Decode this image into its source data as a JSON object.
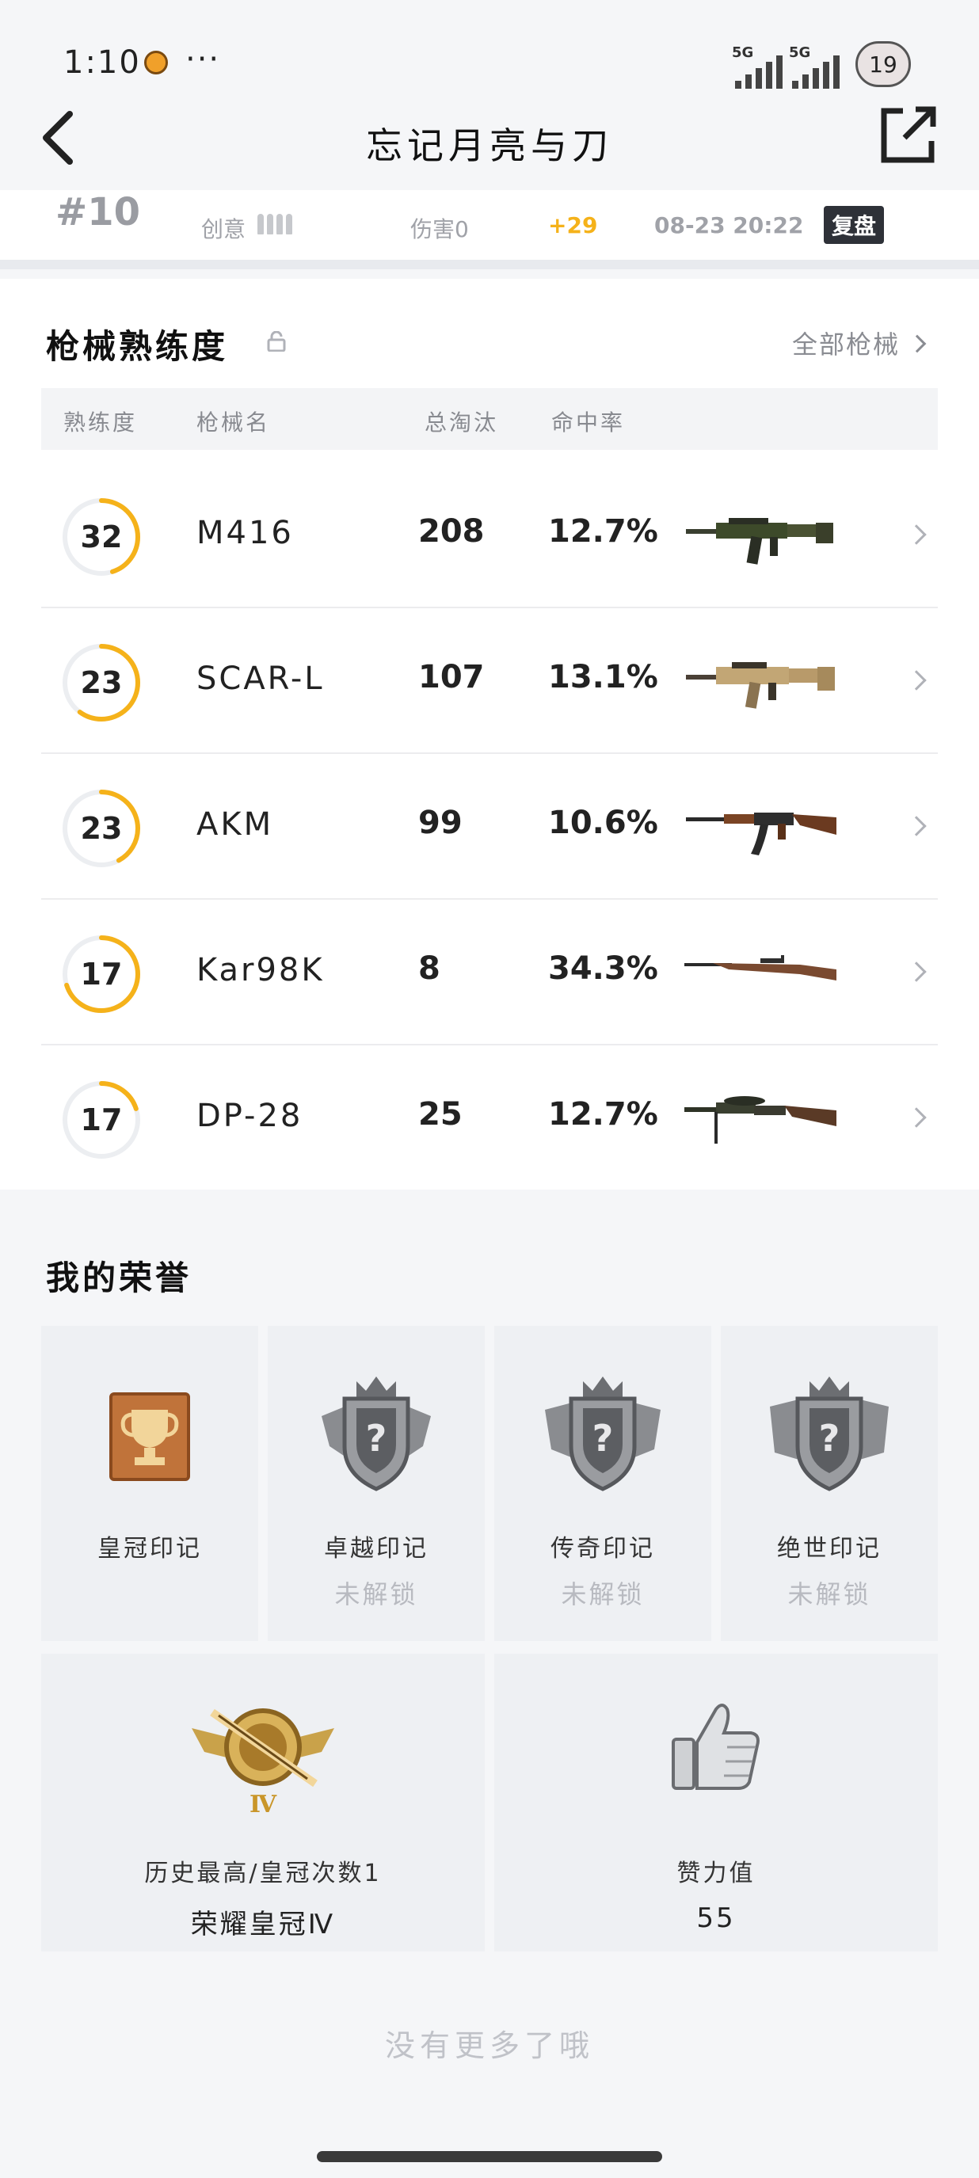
{
  "status_bar": {
    "time": "1:10",
    "more": "···",
    "signal_1_label": "5G",
    "signal_2_label": "5G",
    "battery": "19"
  },
  "header": {
    "title": "忘记月亮与刀"
  },
  "match": {
    "rank": "#10",
    "mode": "创意",
    "damage": "伤害0",
    "rating_change": "+29",
    "datetime": "08-23 20:22",
    "replay_label": "复盘"
  },
  "weapons": {
    "title": "枪械熟练度",
    "all_link": "全部枪械",
    "columns": [
      "熟练度",
      "枪械名",
      "总淘汰",
      "命中率"
    ],
    "rows": [
      {
        "level": "32",
        "name": "M416",
        "kills": "208",
        "accuracy": "12.7%",
        "progress": 0.45,
        "gun_icon": "m416-rifle-icon",
        "gun_color": "#3d4a2a"
      },
      {
        "level": "23",
        "name": "SCAR-L",
        "kills": "107",
        "accuracy": "13.1%",
        "progress": 0.6,
        "gun_icon": "scar-rifle-icon",
        "gun_color": "#b89a6a"
      },
      {
        "level": "23",
        "name": "AKM",
        "kills": "99",
        "accuracy": "10.6%",
        "progress": 0.42,
        "gun_icon": "akm-rifle-icon",
        "gun_color": "#6b3a20"
      },
      {
        "level": "17",
        "name": "Kar98K",
        "kills": "8",
        "accuracy": "34.3%",
        "progress": 0.7,
        "gun_icon": "kar98k-rifle-icon",
        "gun_color": "#7a4a30"
      },
      {
        "level": "17",
        "name": "DP-28",
        "kills": "25",
        "accuracy": "12.7%",
        "progress": 0.2,
        "gun_icon": "dp28-lmg-icon",
        "gun_color": "#5a3a26"
      }
    ]
  },
  "honors": {
    "title": "我的荣誉",
    "marks": [
      {
        "label": "皇冠印记",
        "status": "",
        "icon": "crown-trophy-icon"
      },
      {
        "label": "卓越印记",
        "status": "未解锁",
        "icon": "locked-badge-icon"
      },
      {
        "label": "传奇印记",
        "status": "未解锁",
        "icon": "locked-badge-icon"
      },
      {
        "label": "绝世印记",
        "status": "未解锁",
        "icon": "locked-badge-icon"
      }
    ],
    "highest": {
      "label": "历史最高/皇冠次数1",
      "value": "荣耀皇冠Ⅳ",
      "tier": "Ⅳ",
      "icon": "crown-tier-icon"
    },
    "likes": {
      "label": "赞力值",
      "value": "55",
      "icon": "thumbs-up-icon"
    },
    "no_more": "没有更多了哦"
  },
  "colors": {
    "accent": "#f5b21a",
    "ring_track": "#eceef1"
  }
}
